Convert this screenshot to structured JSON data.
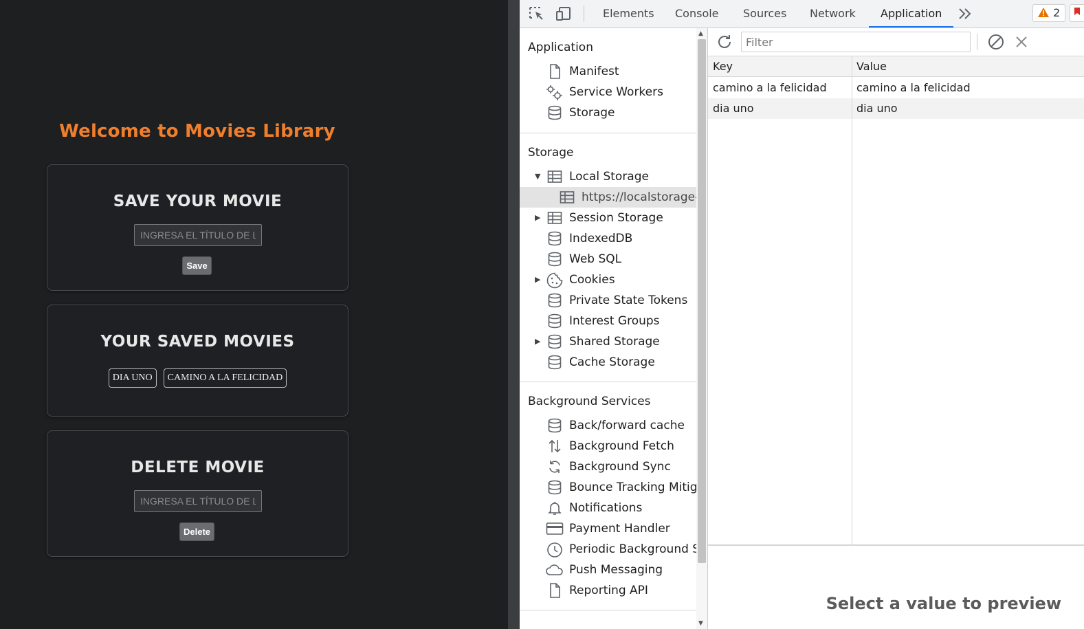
{
  "webpage": {
    "title": "Welcome to Movies Library",
    "save_card": {
      "heading": "SAVE YOUR MOVIE",
      "input_placeholder": "INGRESA EL TÍTULO DE LA",
      "button": "Save"
    },
    "saved_card": {
      "heading": "YOUR SAVED MOVIES",
      "movies": [
        "DIA UNO",
        "CAMINO A LA FELICIDAD"
      ]
    },
    "delete_card": {
      "heading": "DELETE MOVIE",
      "input_placeholder": "INGRESA EL TÍTULO DE LA",
      "button": "Delete"
    }
  },
  "devtools": {
    "tabs": [
      "Elements",
      "Console",
      "Sources",
      "Network",
      "Application"
    ],
    "active_tab": "Application",
    "more_tabs_icon": "chevron-double-right",
    "warning_count": "2",
    "sidebar": {
      "application": {
        "heading": "Application",
        "items": [
          "Manifest",
          "Service Workers",
          "Storage"
        ]
      },
      "storage": {
        "heading": "Storage",
        "items": [
          "Local Storage",
          "https://localstorage-s",
          "Session Storage",
          "IndexedDB",
          "Web SQL",
          "Cookies",
          "Private State Tokens",
          "Interest Groups",
          "Shared Storage",
          "Cache Storage"
        ]
      },
      "background_services": {
        "heading": "Background Services",
        "items": [
          "Back/forward cache",
          "Background Fetch",
          "Background Sync",
          "Bounce Tracking Mitiga",
          "Notifications",
          "Payment Handler",
          "Periodic Background Sy",
          "Push Messaging",
          "Reporting API"
        ]
      }
    },
    "storage_panel": {
      "filter_placeholder": "Filter",
      "columns": [
        "Key",
        "Value"
      ],
      "rows": [
        {
          "key": "camino a la felicidad",
          "value": "camino a la felicidad"
        },
        {
          "key": "dia uno",
          "value": "dia uno"
        }
      ],
      "preview_text": "Select a value to preview"
    }
  }
}
